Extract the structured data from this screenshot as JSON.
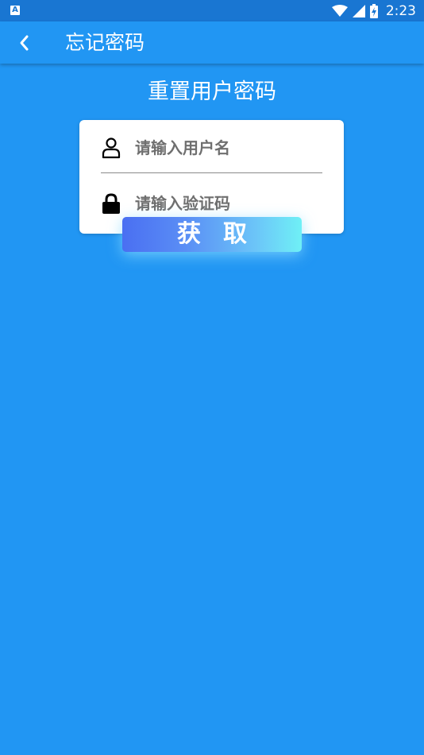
{
  "status_bar": {
    "notification_icon": "A",
    "icons": [
      "wifi-icon",
      "signal-icon",
      "battery-charging-icon"
    ],
    "time": "2:23"
  },
  "app_bar": {
    "back_icon": "chevron-left-icon",
    "title": "忘记密码"
  },
  "page": {
    "heading": "重置用户密码"
  },
  "form": {
    "username": {
      "icon": "user-icon",
      "value": "",
      "placeholder": "请输入用户名"
    },
    "code": {
      "icon": "lock-icon",
      "value": "",
      "placeholder": "请输入验证码"
    },
    "get_button_label": "获取"
  },
  "colors": {
    "primary": "#2196f3",
    "status_bar": "#1976d2",
    "button_gradient_start": "#4a6ff2",
    "button_gradient_end": "#6ff0f6"
  }
}
